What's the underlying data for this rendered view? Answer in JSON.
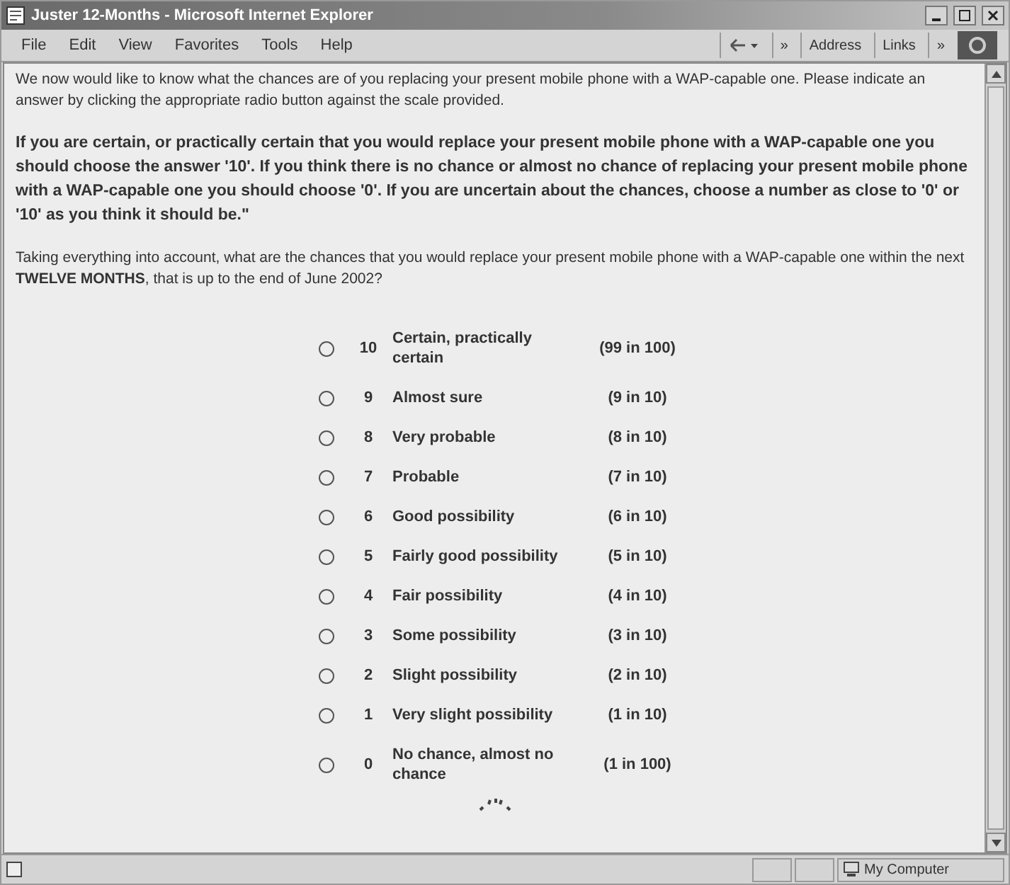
{
  "window": {
    "title": "Juster 12-Months - Microsoft Internet Explorer"
  },
  "menu": [
    "File",
    "Edit",
    "View",
    "Favorites",
    "Tools",
    "Help"
  ],
  "toolbar": {
    "chevron_1": "»",
    "address": "Address",
    "links": "Links",
    "chevron_2": "»"
  },
  "intro": "We now would like to know what the chances are of you replacing your present mobile phone with a WAP-capable one. Please indicate an answer by clicking the appropriate radio button against the scale provided.",
  "instructions": "If you are certain, or practically certain that you would replace your present mobile phone with a WAP-capable one you should choose the answer '10'. If you think there is no chance or almost no chance of replacing your present mobile phone with a WAP-capable one you should choose '0'. If you are uncertain about the chances, choose a number as close to '0' or '10' as you think it should be.\"",
  "question": "Taking everything into account, what are the chances that you would replace your present mobile phone with a WAP-capable one within the next **TWELVE MONTHS**, that is up to the end of June 2002?",
  "options": [
    {
      "value": "10",
      "label": "Certain, practically certain",
      "odds": "(99 in 100)",
      "selected": false
    },
    {
      "value": "9",
      "label": "Almost sure",
      "odds": "(9 in 10)",
      "selected": false
    },
    {
      "value": "8",
      "label": "Very probable",
      "odds": "(8 in 10)",
      "selected": false
    },
    {
      "value": "7",
      "label": "Probable",
      "odds": "(7 in 10)",
      "selected": false
    },
    {
      "value": "6",
      "label": "Good possibility",
      "odds": "(6 in 10)",
      "selected": false
    },
    {
      "value": "5",
      "label": "Fairly good possibility",
      "odds": "(5 in 10)",
      "selected": false
    },
    {
      "value": "4",
      "label": "Fair possibility",
      "odds": "(4 in 10)",
      "selected": false
    },
    {
      "value": "3",
      "label": "Some possibility",
      "odds": "(3 in 10)",
      "selected": false
    },
    {
      "value": "2",
      "label": "Slight possibility",
      "odds": "(2 in 10)",
      "selected": false
    },
    {
      "value": "1",
      "label": "Very slight possibility",
      "odds": "(1 in 10)",
      "selected": false
    },
    {
      "value": "0",
      "label": "No chance, almost no chance",
      "odds": "(1 in 100)",
      "selected": false
    }
  ],
  "status_bar": {
    "zone": "My Computer"
  }
}
